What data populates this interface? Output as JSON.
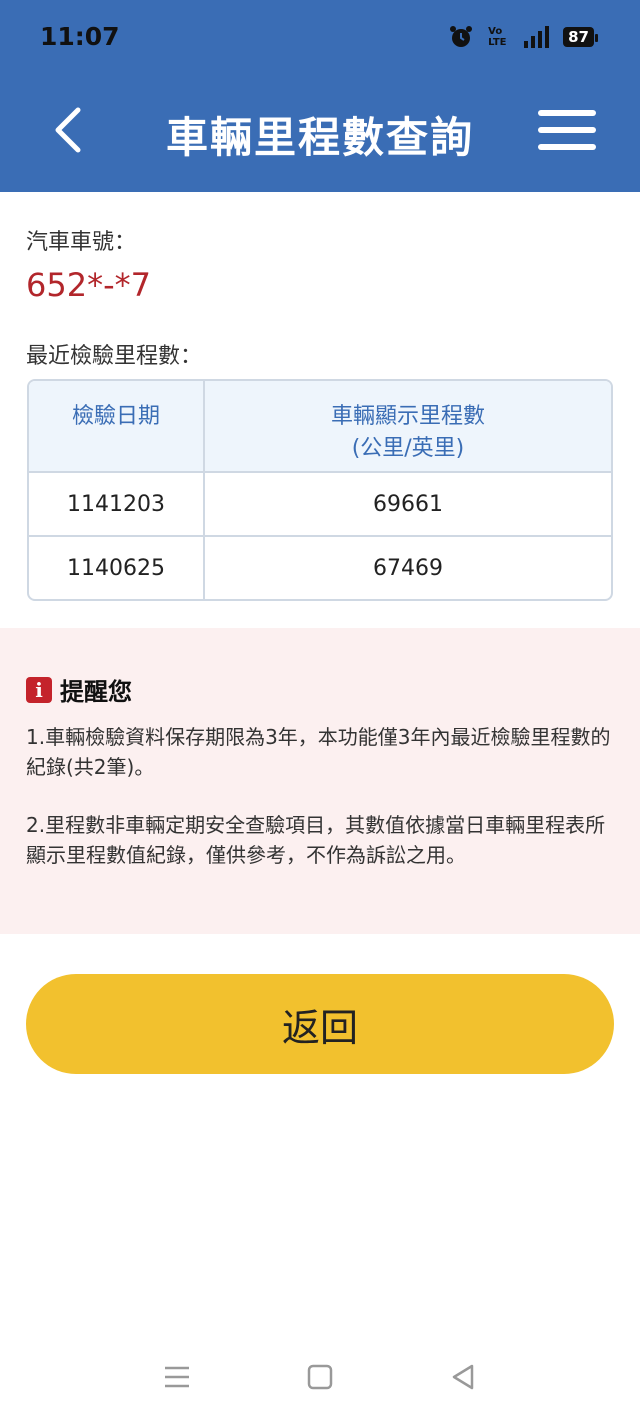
{
  "status_bar": {
    "time": "11:07",
    "volte_top": "Vo",
    "volte_bottom": "LTE",
    "battery": "87"
  },
  "header": {
    "title": "車輛里程數查詢",
    "back_icon": "chevron-left-icon",
    "menu_icon": "hamburger-menu-icon"
  },
  "vehicle": {
    "plate_label": "汽車車號：",
    "plate_number": "652*-*7"
  },
  "mileage": {
    "section_label": "最近檢驗里程數：",
    "columns": [
      "檢驗日期",
      "車輛顯示里程數",
      "(公里/英里)"
    ],
    "rows": [
      {
        "date": "1141203",
        "mileage": "69661"
      },
      {
        "date": "1140625",
        "mileage": "67469"
      }
    ]
  },
  "notice": {
    "icon": "info-icon",
    "icon_glyph": "i",
    "title": "提醒您",
    "items": [
      "1.車輛檢驗資料保存期限為3年，本功能僅3年內最近檢驗里程數的紀錄(共2筆)。",
      "2.里程數非車輛定期安全查驗項目，其數值依據當日車輛里程表所顯示里程數值紀錄，僅供參考，不作為訴訟之用。"
    ]
  },
  "actions": {
    "return_label": "返回"
  },
  "colors": {
    "header_bg": "#3a6db5",
    "plate": "#b2262b",
    "button": "#f2c12e",
    "notice_bg": "#fcf0f0"
  }
}
